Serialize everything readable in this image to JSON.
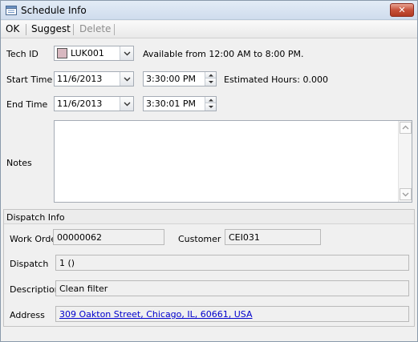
{
  "window": {
    "title": "Schedule Info",
    "close_label": "✕"
  },
  "toolbar": {
    "ok_label": "OK",
    "suggest_label": "Suggest",
    "delete_label": "Delete"
  },
  "form": {
    "tech_id_label": "Tech ID",
    "tech_id_value": "LUK001",
    "availability": "Available from 12:00 AM to 8:00 PM.",
    "start_time_label": "Start Time",
    "start_date": "11/6/2013",
    "start_time": "3:30:00 PM",
    "estimated_hours": "Estimated Hours: 0.000",
    "end_time_label": "End Time",
    "end_date": "11/6/2013",
    "end_time": "3:30:01 PM",
    "notes_label": "Notes",
    "notes_value": ""
  },
  "dispatch": {
    "header": "Dispatch Info",
    "work_order_label": "Work Orde",
    "work_order_value": "00000062",
    "customer_label": "Customer",
    "customer_value": "CEI031",
    "dispatch_label": "Dispatch",
    "dispatch_value": "1 ()",
    "description_label": "Description",
    "description_value": "Clean filter",
    "address_label": "Address",
    "address_value": "309 Oakton Street, Chicago, IL, 60661, USA"
  },
  "colors": {
    "tech_swatch": "#d8b8c0",
    "close_button": "#c7513a",
    "link": "#0000cc"
  }
}
